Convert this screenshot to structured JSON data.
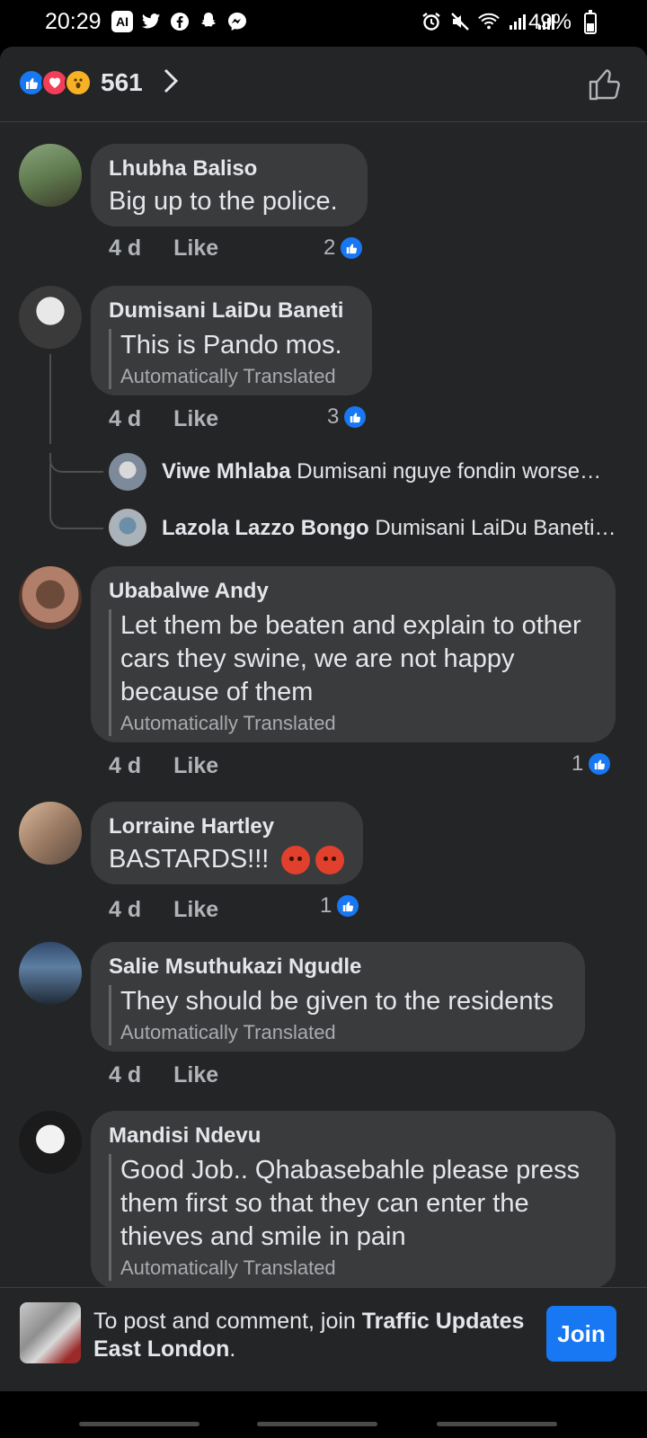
{
  "status_bar": {
    "time": "20:29",
    "left_icons": [
      "ai-icon",
      "twitter-icon",
      "facebook-icon",
      "snapchat-icon",
      "messenger-icon"
    ],
    "right_icons": [
      "alarm-icon",
      "mute-icon",
      "wifi-icon",
      "signal-icon",
      "signal-icon"
    ],
    "battery_text": "49%",
    "battery_level": 0.49
  },
  "reactions": {
    "emojis": [
      "like",
      "love",
      "wow"
    ],
    "count": "561"
  },
  "comments": [
    {
      "name": "Lhubha Baliso",
      "text": "Big up to the police.",
      "time": "4 d",
      "like_label": "Like",
      "likes": "2"
    },
    {
      "name": "Dumisani LaiDu Baneti",
      "text": "This is Pando mos.",
      "translated": "Automatically Translated",
      "time": "4 d",
      "like_label": "Like",
      "likes": "3"
    },
    {
      "name": "Ubabalwe Andy",
      "text": "Let them be beaten and explain to other cars they swine, we are not happy because of them",
      "translated": "Automatically Translated",
      "time": "4 d",
      "like_label": "Like",
      "likes": "1"
    },
    {
      "name": "Lorraine Hartley",
      "text": "BASTARDS!!!",
      "time": "4 d",
      "like_label": "Like",
      "likes": "1"
    },
    {
      "name": "Salie Msuthukazi Ngudle",
      "text": "They should be given to the residents",
      "translated": "Automatically Translated",
      "time": "4 d",
      "like_label": "Like"
    },
    {
      "name": "Mandisi Ndevu",
      "text": "Good Job.. Qhabasebahle please press them first so that they can enter the thieves and smile in pain",
      "translated": "Automatically Translated"
    }
  ],
  "replies": [
    {
      "name": "Viwe Mhlaba",
      "text": "Dumisani nguye fondin worse…"
    },
    {
      "name": "Lazola Lazzo Bongo",
      "text": "Dumisani LaiDu Baneti…"
    }
  ],
  "footer": {
    "prefix": "To post and comment, join ",
    "group_name": "Traffic Updates East London",
    "suffix": ".",
    "join_label": "Join"
  },
  "colors": {
    "background": "#242526",
    "bubble": "#3a3b3c",
    "accent": "#1877f2"
  }
}
